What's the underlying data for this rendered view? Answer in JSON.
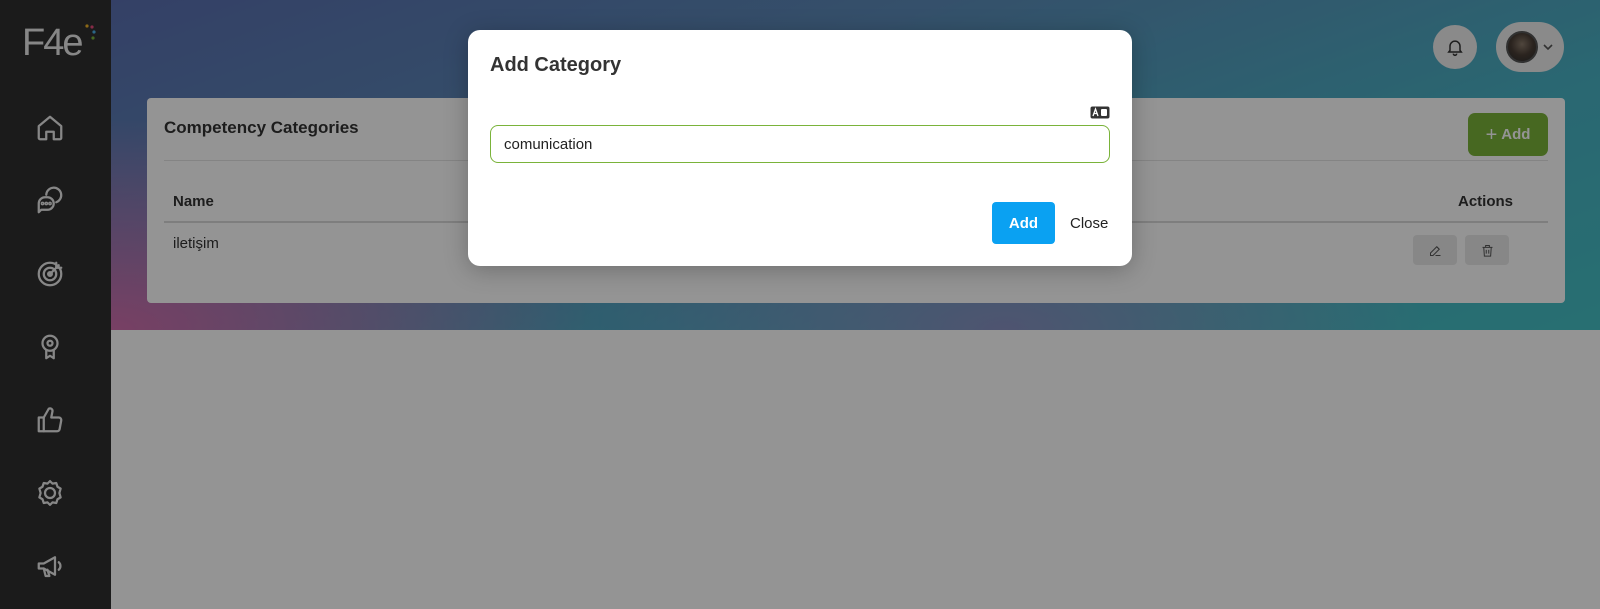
{
  "app": {
    "logo_text": "F4e"
  },
  "sidebar": {
    "items": [
      {
        "icon": "home-icon"
      },
      {
        "icon": "chat-icon"
      },
      {
        "icon": "target-icon"
      },
      {
        "icon": "award-icon"
      },
      {
        "icon": "thumbs-up-icon"
      },
      {
        "icon": "settings-icon"
      },
      {
        "icon": "megaphone-icon"
      }
    ]
  },
  "header": {
    "notification_icon": "bell-icon",
    "user_menu_icon": "chevron-down-icon"
  },
  "card": {
    "title": "Competency Categories",
    "add_button_label": "Add",
    "table": {
      "columns": [
        "Name",
        "Actions"
      ],
      "rows": [
        {
          "name": "iletişim"
        }
      ]
    }
  },
  "modal": {
    "title": "Add Category",
    "input_value": "comunication",
    "add_label": "Add",
    "close_label": "Close"
  },
  "colors": {
    "sidebar_bg": "#2f2f2f",
    "accent_green": "#7ab33a",
    "primary_blue": "#0aa1f2"
  }
}
